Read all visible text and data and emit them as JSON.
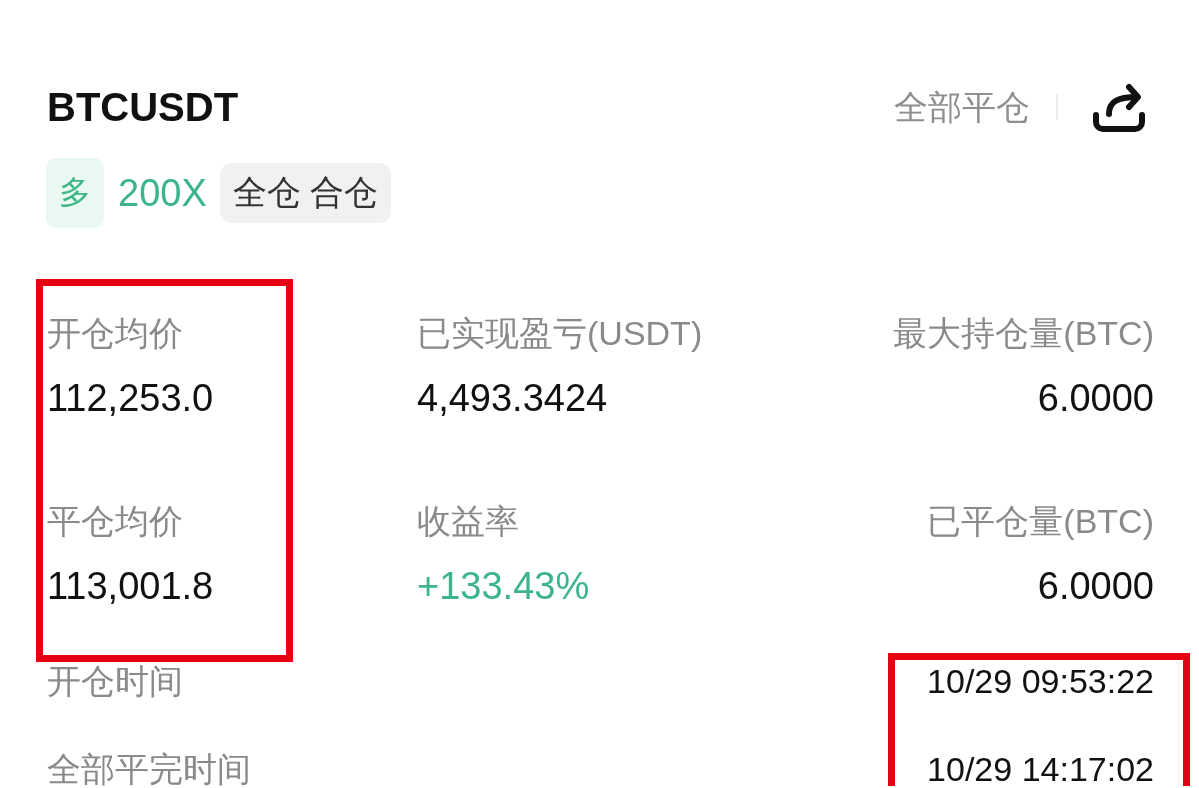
{
  "header": {
    "title": "BTCUSDT",
    "close_all_button": "全部平仓"
  },
  "tags": [
    {
      "kind": "side",
      "text": "多"
    },
    {
      "kind": "leverage",
      "text": "200X"
    },
    {
      "kind": "mode",
      "text": "全仓 合仓"
    }
  ],
  "stats": {
    "columns": [
      {
        "highlighted": true,
        "items": [
          {
            "label": "开仓均价",
            "value": "112,253.0",
            "color": "#111111"
          },
          {
            "label": "平仓均价",
            "value": "113,001.8",
            "color": "#111111"
          }
        ]
      },
      {
        "highlighted": false,
        "items": [
          {
            "label": "已实现盈亏(USDT)",
            "value": "4,493.3424",
            "color": "#111111"
          },
          {
            "label": "收益率",
            "value": "+133.43%",
            "color": "#3db489"
          }
        ]
      },
      {
        "highlighted": false,
        "items": [
          {
            "label": "最大持仓量(BTC)",
            "value": "6.0000",
            "color": "#111111"
          },
          {
            "label": "已平仓量(BTC)",
            "value": "6.0000",
            "color": "#111111"
          }
        ]
      }
    ]
  },
  "times": {
    "values_highlighted": true,
    "rows": [
      {
        "label": "开仓时间",
        "value": "10/29 09:53:22"
      },
      {
        "label": "全部平完时间",
        "value": "10/29 14:17:02"
      }
    ]
  }
}
